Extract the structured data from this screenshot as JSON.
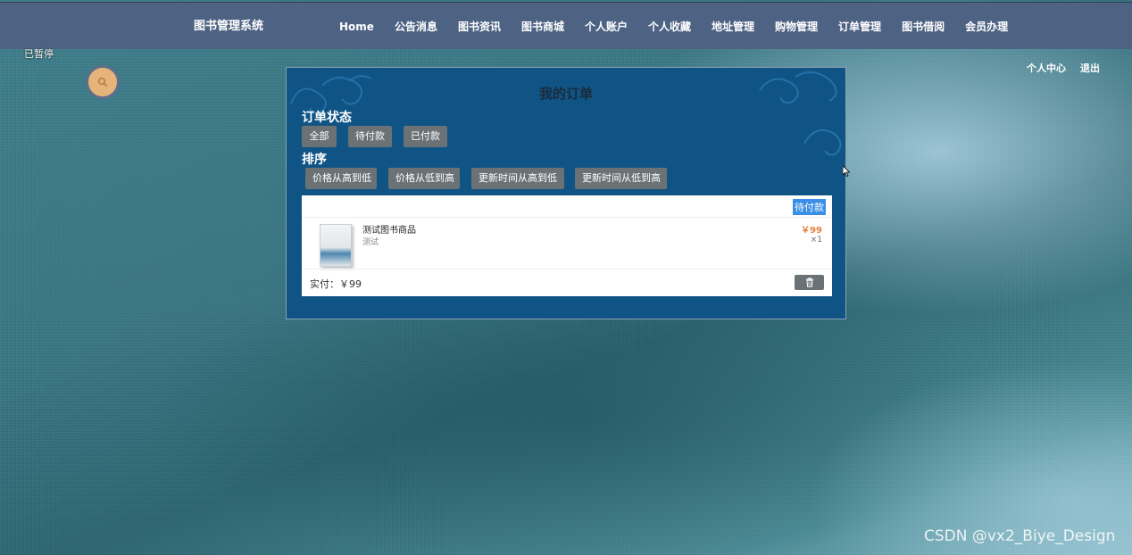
{
  "nav": {
    "brand": "图书管理系统",
    "items": [
      {
        "label": "Home"
      },
      {
        "label": "公告消息"
      },
      {
        "label": "图书资讯"
      },
      {
        "label": "图书商城"
      },
      {
        "label": "个人账户"
      },
      {
        "label": "个人收藏"
      },
      {
        "label": "地址管理"
      },
      {
        "label": "购物管理"
      },
      {
        "label": "订单管理"
      },
      {
        "label": "图书借阅"
      },
      {
        "label": "会员办理"
      }
    ]
  },
  "overlay": {
    "paused_label": "已暂停",
    "search_icon": "search-icon"
  },
  "user_links": {
    "center": "个人中心",
    "logout": "退出"
  },
  "orders": {
    "title": "我的订单",
    "status_label": "订单状态",
    "status_filters": [
      "全部",
      "待付款",
      "已付款"
    ],
    "sort_label": "排序",
    "sort_options": [
      "价格从高到低",
      "价格从低到高",
      "更新时间从高到低",
      "更新时间从低到高"
    ],
    "list": [
      {
        "status": "待付款",
        "item_name": "测试图书商品",
        "item_desc": "测试",
        "price": "￥99",
        "quantity": "×1",
        "paid_label": "实付：",
        "paid_amount": "￥99",
        "delete_icon": "trash-icon"
      }
    ]
  },
  "watermark": "CSDN @vx2_Biye_Design",
  "colors": {
    "navbar": "#4e6384",
    "panel": "#0f5485",
    "button": "#6b7276",
    "status_tag": "#3a8ee6",
    "price": "#e8823a"
  }
}
